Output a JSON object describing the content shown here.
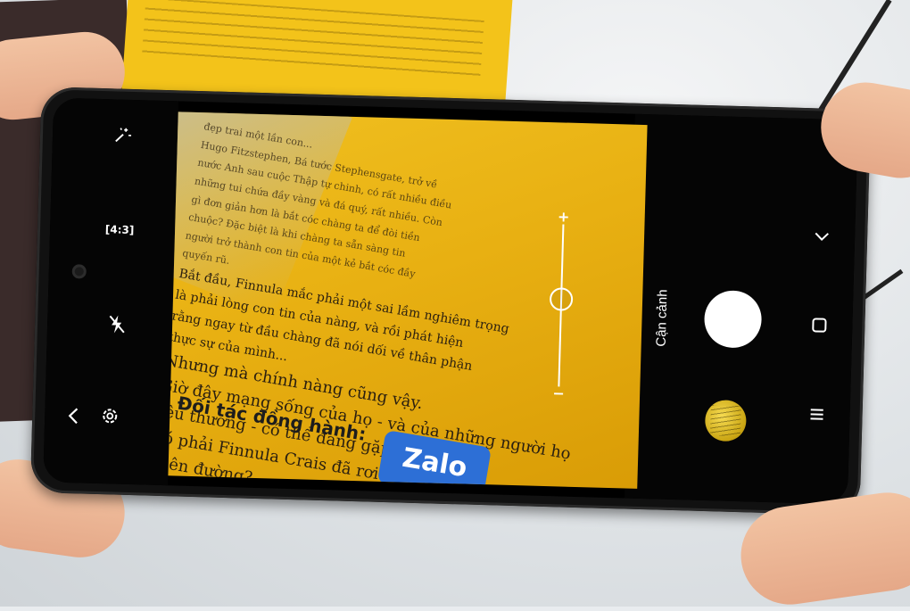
{
  "camera_ui": {
    "mode_label": "Cận cảnh",
    "aspect_ratio_label": "4:3",
    "zoom_plus": "+",
    "zoom_minus": "−",
    "zoom_level": 0.55,
    "icons": {
      "magic": "magic-wand-icon",
      "ratio": "aspect-ratio-icon",
      "flash": "flash-off-icon",
      "back": "chevron-left-icon",
      "settings": "gear-icon",
      "expand": "chevron-down-icon",
      "switch": "square-icon",
      "menu": "hamburger-menu-icon"
    }
  },
  "viewfinder": {
    "text_lines": [
      "đẹp trai một lần con...",
      "Hugo Fitzstephen, Bá tước Stephensgate, trở về",
      "nước Anh sau cuộc Thập tự chinh, có rất nhiều điều",
      "những tui chứa đầy vàng và đá quý, rất nhiều. Còn",
      "gì đơn giản hơn là bắt cóc chàng ta để đòi tiền",
      "chuộc? Đặc biệt là khi chàng ta sẵn sàng tin",
      "người trở thành con tin của một kẻ bắt cóc đầy",
      "quyến rũ.",
      "Bắt đầu, Finnula mắc phải một sai lầm nghiêm trọng",
      "là phải lòng con tin của nàng, và rồi phát hiện",
      "rằng ngay từ đầu chàng đã nói dối về thân phận",
      "thực sự của mình...",
      "Nhưng mà chính nàng cũng vậy.",
      "Giờ đây mạng sống của họ - và của những người họ",
      "yêu thương - có thể đang gặp nguy hiểm.",
      "Có phải Finnula Crais đã rơi vào địa ngục? Hay lên",
      "thiên đường?"
    ],
    "partner_label": "Đối tác đồng hành:",
    "logo_text": "Zalo"
  }
}
